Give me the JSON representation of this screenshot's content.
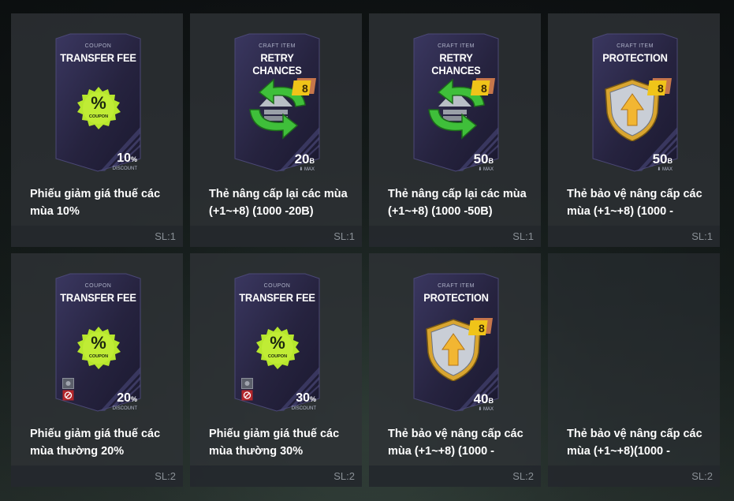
{
  "tiles": [
    {
      "kind": "coupon",
      "card_sub": "COUPON",
      "card_title": "TRANSFER FEE",
      "badge_symbol": "%",
      "badge_label": "COUPON",
      "value": "10",
      "unit": "%",
      "value_label": "DISCOUNT",
      "locked": false,
      "description": "Phiếu giảm giá thuế các\nmùa 10%",
      "quantity": "SL:1"
    },
    {
      "kind": "retry",
      "card_sub": "CRAFT ITEM",
      "card_title": "RETRY CHANCES",
      "level_badge": "8",
      "value": "20",
      "unit": "B",
      "value_label": "MAX",
      "description": "Thẻ nâng cấp lại các mùa\n(+1~+8) (1000 -20B)",
      "quantity": "SL:1"
    },
    {
      "kind": "retry",
      "card_sub": "CRAFT ITEM",
      "card_title": "RETRY CHANCES",
      "level_badge": "8",
      "value": "50",
      "unit": "B",
      "value_label": "MAX",
      "description": "Thẻ nâng cấp lại các mùa\n(+1~+8) (1000 -50B)",
      "quantity": "SL:1"
    },
    {
      "kind": "protect",
      "card_sub": "CRAFT ITEM",
      "card_title": "PROTECTION",
      "level_badge": "8",
      "value": "50",
      "unit": "B",
      "value_label": "MAX",
      "description": "Thẻ bảo vệ nâng cấp các\nmùa (+1~+8) (1000 -",
      "quantity": "SL:1"
    },
    {
      "kind": "coupon",
      "card_sub": "COUPON",
      "card_title": "TRANSFER FEE",
      "badge_symbol": "%",
      "badge_label": "COUPON",
      "value": "20",
      "unit": "%",
      "value_label": "DISCOUNT",
      "locked": true,
      "description": "Phiếu giảm giá thuế các\nmùa thường 20%",
      "quantity": "SL:2"
    },
    {
      "kind": "coupon",
      "card_sub": "COUPON",
      "card_title": "TRANSFER FEE",
      "badge_symbol": "%",
      "badge_label": "COUPON",
      "value": "30",
      "unit": "%",
      "value_label": "DISCOUNT",
      "locked": true,
      "description": "Phiếu giảm giá thuế các\nmùa thường 30%",
      "quantity": "SL:2"
    },
    {
      "kind": "protect",
      "card_sub": "CRAFT ITEM",
      "card_title": "PROTECTION",
      "level_badge": "8",
      "value": "40",
      "unit": "B",
      "value_label": "MAX",
      "description": "Thẻ bảo vệ nâng cấp các\nmùa (+1~+8) (1000 -",
      "quantity": "SL:2"
    },
    {
      "kind": "empty",
      "description": "Thẻ bảo vệ nâng cấp các\nmùa (+1~+8)(1000 -",
      "quantity": "SL:2"
    }
  ],
  "colors": {
    "card_dark": "#25223f",
    "card_light": "#37345a",
    "coupon_badge": "#b6e62d",
    "arrow_green": "#3fbf3a",
    "shield_gold": "#d9a530",
    "level_badge": "#f0c419"
  },
  "icons": [
    "coupon-badge-icon",
    "retry-arrows-icon",
    "shield-icon",
    "lock-icon",
    "max-level-icon"
  ]
}
